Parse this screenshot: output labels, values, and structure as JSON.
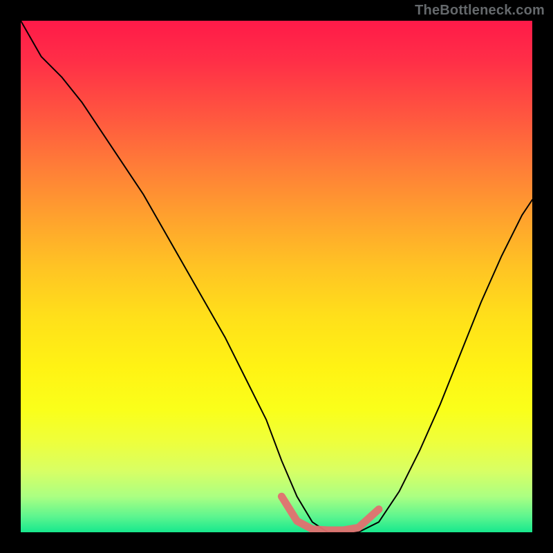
{
  "attribution": "TheBottleneck.com",
  "chart_data": {
    "type": "line",
    "title": "",
    "xlabel": "",
    "ylabel": "",
    "xlim": [
      0,
      100
    ],
    "ylim": [
      0,
      100
    ],
    "gradient_stops": [
      {
        "offset": 0.0,
        "color": "#ff1a49"
      },
      {
        "offset": 0.08,
        "color": "#ff2f47"
      },
      {
        "offset": 0.18,
        "color": "#ff5440"
      },
      {
        "offset": 0.28,
        "color": "#ff7b38"
      },
      {
        "offset": 0.38,
        "color": "#ffa02e"
      },
      {
        "offset": 0.48,
        "color": "#ffc324"
      },
      {
        "offset": 0.58,
        "color": "#ffe01a"
      },
      {
        "offset": 0.68,
        "color": "#fff314"
      },
      {
        "offset": 0.76,
        "color": "#faff1a"
      },
      {
        "offset": 0.82,
        "color": "#efff3a"
      },
      {
        "offset": 0.88,
        "color": "#d8ff64"
      },
      {
        "offset": 0.93,
        "color": "#abff82"
      },
      {
        "offset": 0.97,
        "color": "#5bf58f"
      },
      {
        "offset": 1.0,
        "color": "#17e88d"
      }
    ],
    "series": [
      {
        "name": "bottleneck-curve",
        "color": "#000000",
        "x": [
          0,
          4,
          8,
          12,
          16,
          20,
          24,
          28,
          32,
          36,
          40,
          44,
          48,
          51,
          54,
          57,
          60,
          63,
          66,
          70,
          74,
          78,
          82,
          86,
          90,
          94,
          98,
          100
        ],
        "y": [
          100,
          93,
          89,
          84,
          78,
          72,
          66,
          59,
          52,
          45,
          38,
          30,
          22,
          14,
          7,
          2,
          0,
          0,
          0,
          2,
          8,
          16,
          25,
          35,
          45,
          54,
          62,
          65
        ]
      }
    ],
    "valley_marker": {
      "name": "sweet-spot",
      "color": "#e27070",
      "stroke_width": 11,
      "x": [
        51,
        54,
        57,
        60,
        63,
        66,
        70
      ],
      "y": [
        7,
        2.2,
        0.6,
        0.4,
        0.4,
        0.9,
        4.5
      ]
    }
  }
}
